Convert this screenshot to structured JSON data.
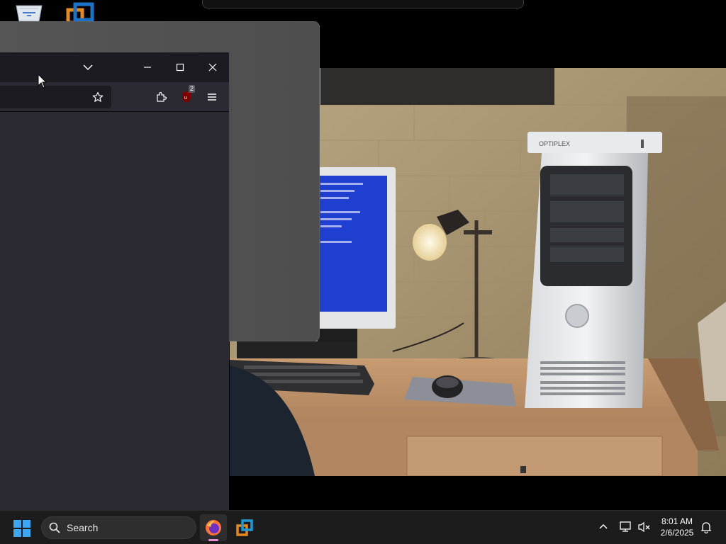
{
  "desktop": {
    "icons": [
      {
        "name": "recycle-bin-icon"
      },
      {
        "name": "vmware-icon"
      }
    ]
  },
  "photo": {
    "subject": "office desk with monitor, desk lamp, keyboard, mouse and tower PC",
    "monitor_screen_color": "#1f3fd1",
    "pc_brand_label": "OPTIPLEX"
  },
  "firefox_window": {
    "titlebar": {
      "buttons": [
        "list-all-tabs",
        "minimize",
        "maximize",
        "close"
      ]
    },
    "toolbar": {
      "extension_badge": "2"
    }
  },
  "taskbar": {
    "search_label": "Search",
    "clock_time": "8:01 AM",
    "clock_date": "2/6/2025",
    "accent_color": "#e58fd6"
  }
}
